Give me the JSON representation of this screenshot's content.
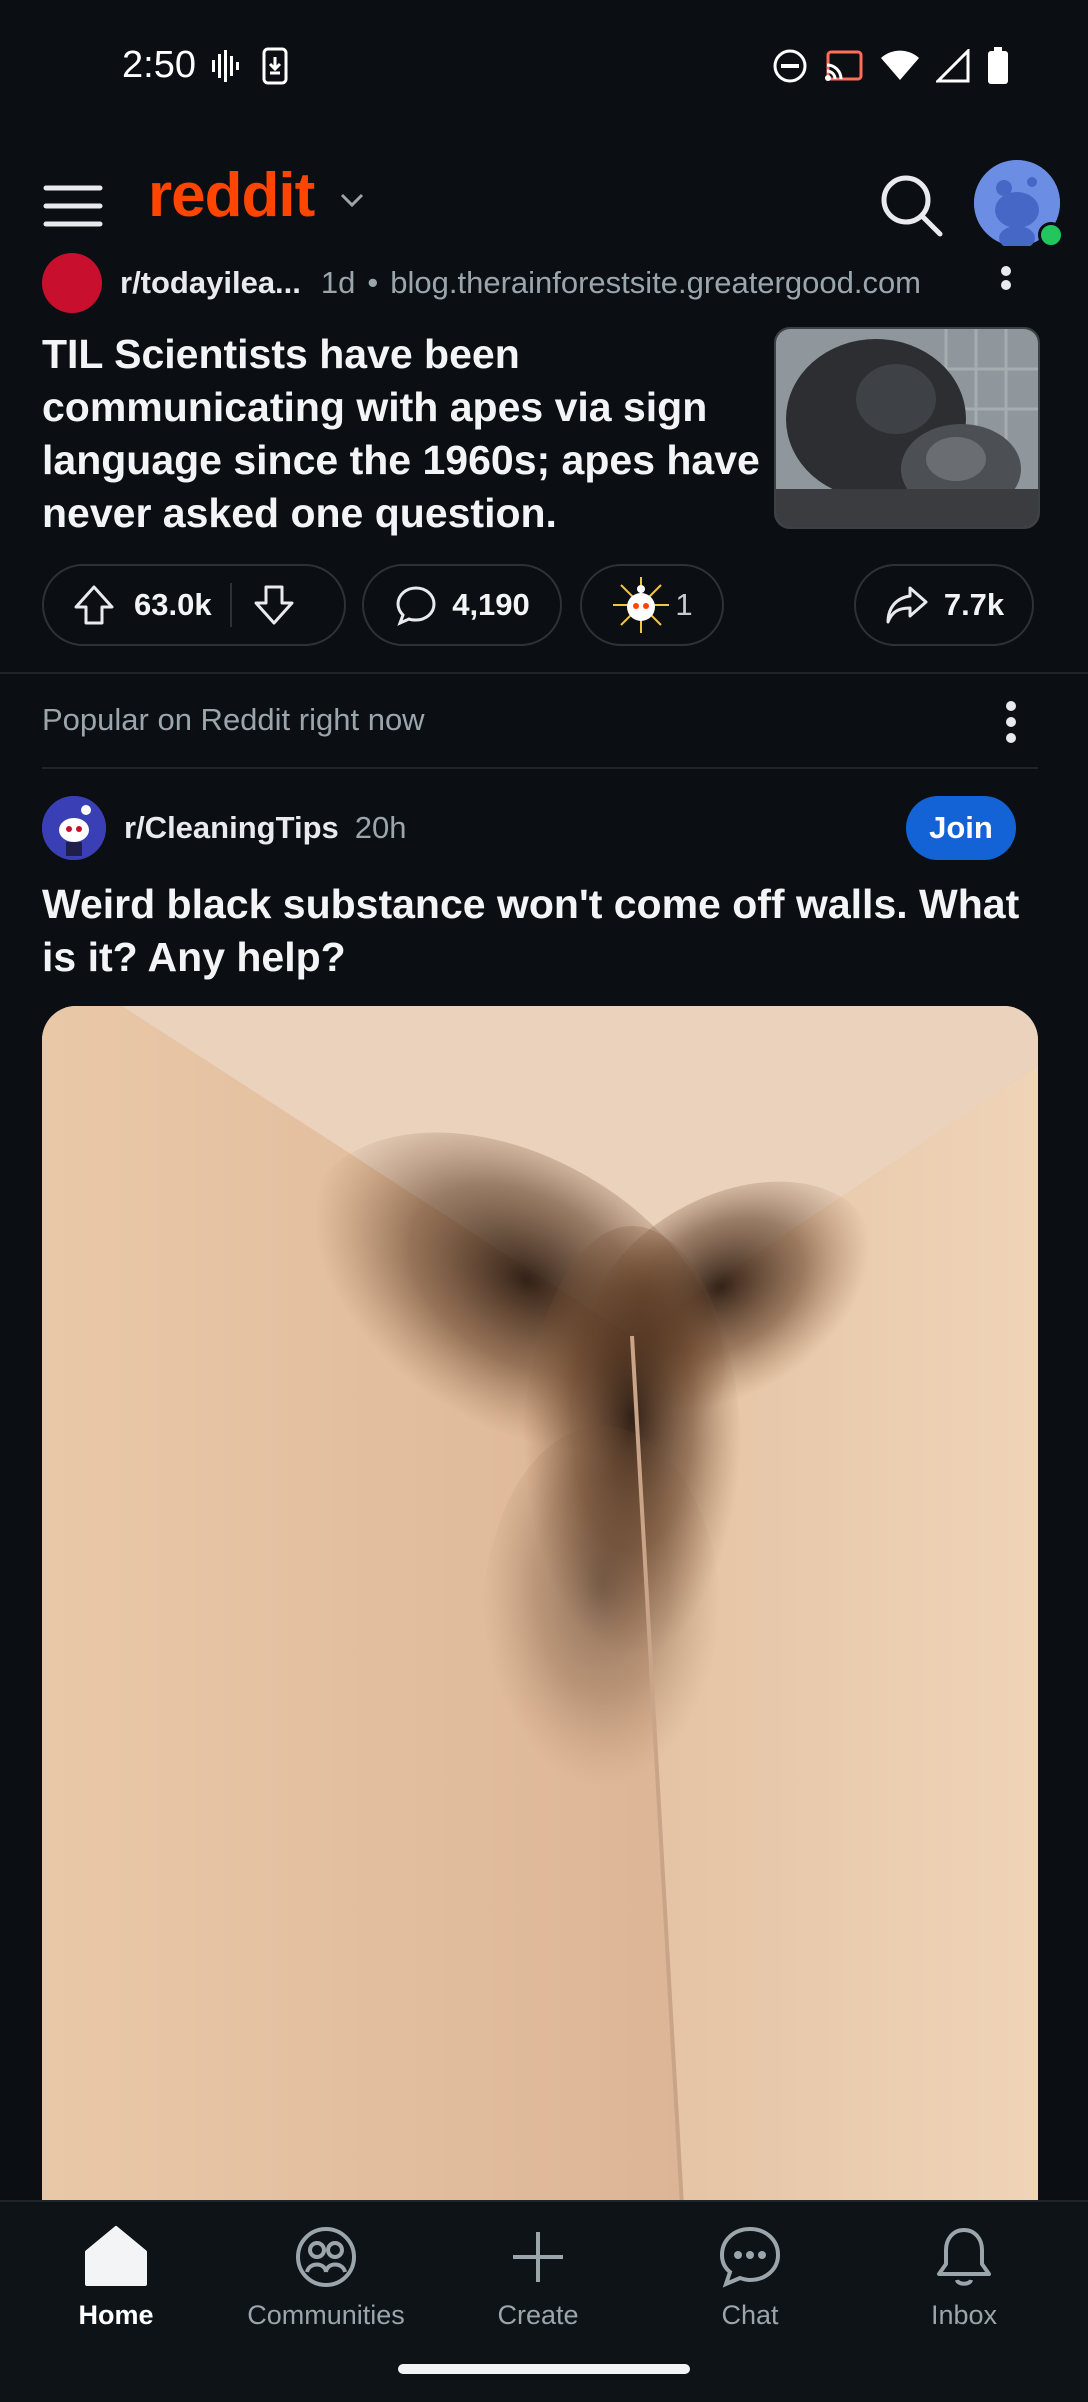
{
  "status_bar": {
    "time": "2:50"
  },
  "app_bar": {
    "logo": "reddit"
  },
  "post1": {
    "subreddit": "r/todayilea...",
    "age": "1d",
    "separator": "•",
    "domain": "blog.therainforestsite.greatergood.com",
    "title": "TIL Scientists have been communicating with apes via sign language since the 1960s; apes have never asked one question.",
    "upvotes": "63.0k",
    "comments": "4,190",
    "awards": "1",
    "shares": "7.7k"
  },
  "popular": {
    "label": "Popular on Reddit right now"
  },
  "post2": {
    "subreddit": "r/CleaningTips",
    "age": "20h",
    "join_label": "Join",
    "title": "Weird black substance won't come off walls. What is it? Any help?"
  },
  "bottom_nav": {
    "items": [
      {
        "label": "Home",
        "icon": "home-icon"
      },
      {
        "label": "Communities",
        "icon": "communities-icon"
      },
      {
        "label": "Create",
        "icon": "plus-icon"
      },
      {
        "label": "Chat",
        "icon": "chat-icon"
      },
      {
        "label": "Inbox",
        "icon": "bell-icon"
      }
    ]
  },
  "colors": {
    "brand": "#ff4500",
    "join": "#1463d6",
    "background": "#0b0f13"
  }
}
